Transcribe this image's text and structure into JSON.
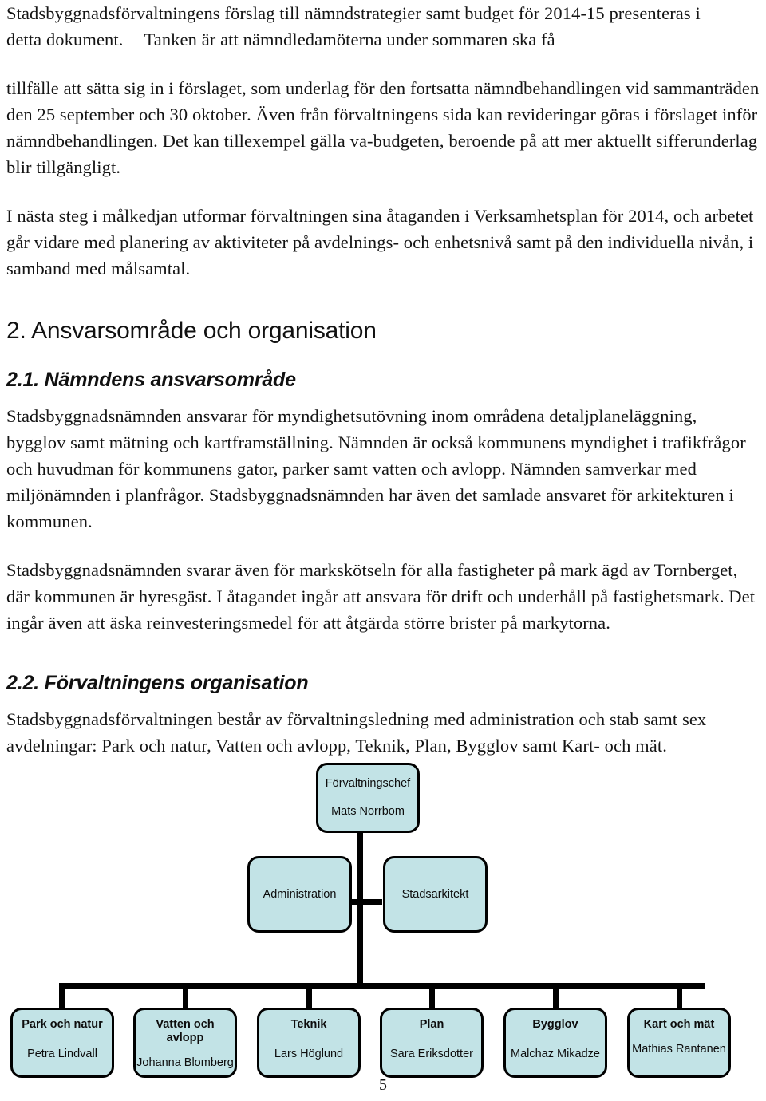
{
  "document": {
    "page_number": "5",
    "paragraphs": [
      {
        "id": "intro_line1",
        "text": "Stadsbyggnadsförvaltningens förslag till nämndstrategier samt budget för 2014-15 presenteras i"
      },
      {
        "id": "intro_line2a",
        "text": "detta dokument."
      },
      {
        "id": "intro_line2b",
        "text": "Tanken är att nämndledamöterna under sommaren ska få"
      },
      {
        "id": "para_tillfalle",
        "text": "tillfälle att sätta sig in i förslaget, som underlag för den fortsatta nämndbehandlingen vid sammanträden den 25 september och 30 oktober. Även från förvaltningens sida kan revideringar göras i förslaget inför nämndbehandlingen. Det kan tillexempel gälla va-budgeten, beroende på att mer aktuellt sifferunderlag blir tillgängligt."
      },
      {
        "id": "para_nasta_steg",
        "text": "I nästa steg i målkedjan utformar förvaltningen sina åtaganden i Verksamhetsplan för 2014, och arbetet går vidare med planering av aktiviteter på avdelnings- och enhetsnivå samt på den individuella nivån, i samband med målsamtal."
      },
      {
        "id": "para_ansvar_1",
        "text": "Stadsbyggnadsnämnden ansvarar för myndighetsutövning inom områdena detaljplaneläggning, bygglov samt mätning och kartframställning. Nämnden är också kommunens myndighet i trafikfrågor och huvudman för kommunens gator, parker samt vatten och avlopp. Nämnden samverkar med miljönämnden i planfrågor. Stadsbyggnadsnämnden har även det samlade ansvaret för arkitekturen i kommunen."
      },
      {
        "id": "para_ansvar_2",
        "text": "Stadsbyggnadsnämnden svarar även för markskötseln för alla fastigheter på mark ägd av Tornberget, där kommunen är hyresgäst. I åtagandet ingår att ansvara för drift och underhåll på fastighetsmark. Det ingår även att äska reinvesteringsmedel för att åtgärda större brister på markytorna."
      },
      {
        "id": "para_organisation",
        "text": "Stadsbyggnadsförvaltningen består av förvaltningsledning med administration och stab samt sex avdelningar: Park och natur, Vatten och avlopp, Teknik, Plan, Bygglov samt Kart- och mät."
      }
    ],
    "headings": {
      "section_2": "2. Ansvarsområde och organisation",
      "section_2_1": "2.1. Nämndens ansvarsområde",
      "section_2_2": "2.2. Förvaltningens organisation"
    }
  },
  "org_chart": {
    "colors": {
      "node_fill": "#c2e3e6",
      "node_border": "#000000",
      "connector": "#000000",
      "text": "#0d0d0d"
    },
    "top": {
      "title": "Förvaltningschef",
      "person": "Mats Norrbom"
    },
    "staff": [
      {
        "title": "Administration",
        "person": ""
      },
      {
        "title": "Stadsarkitekt",
        "person": ""
      }
    ],
    "departments": [
      {
        "title": "Park och natur",
        "person": "Petra Lindvall"
      },
      {
        "title": "Vatten och avlopp",
        "person": "Johanna Blomberg"
      },
      {
        "title": "Teknik",
        "person": "Lars Höglund"
      },
      {
        "title": "Plan",
        "person": "Sara Eriksdotter"
      },
      {
        "title": "Bygglov",
        "person": "Malchaz Mikadze"
      },
      {
        "title": "Kart och mät",
        "person": "Mathias Rantanen"
      }
    ]
  }
}
